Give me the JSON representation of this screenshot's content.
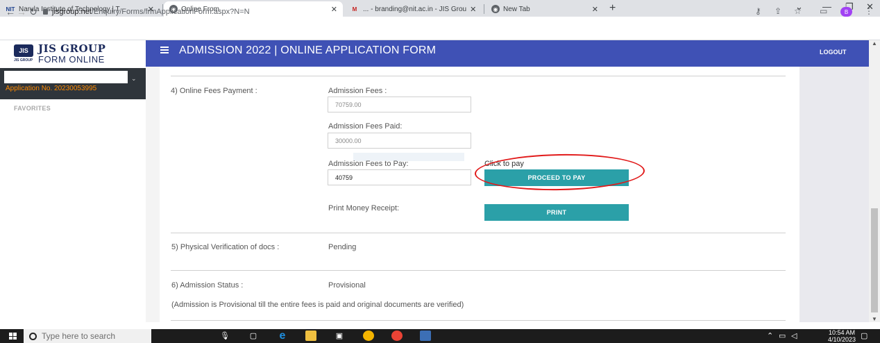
{
  "browser": {
    "tabs": [
      {
        "title": "Narula Institute of Technology | T",
        "favicon": "NIT"
      },
      {
        "title": "Online From",
        "favicon": "globe"
      },
      {
        "title": "... - branding@nit.ac.in - JIS Grou",
        "favicon": "mail"
      },
      {
        "title": "New Tab",
        "favicon": "globe"
      }
    ],
    "url_host": "jisgroup.net",
    "url_path": "/Enquiry/Forms/frmApplicationForm.aspx?N=N",
    "profile_initial": "B"
  },
  "header": {
    "logo_mark": "JIS",
    "logo_sub": "JIS GROUP",
    "logo_line1": "JIS GROUP",
    "logo_line2": "FORM ONLINE",
    "title": "ADMISSION 2022 | ONLINE APPLICATION FORM",
    "logout": "LOGOUT"
  },
  "sidebar": {
    "application_no": "Application No. 20230053995",
    "favorites": "FAVORITES"
  },
  "form": {
    "fees_section_label": "4) Online Fees Payment :",
    "admission_fees_label": "Admission Fees :",
    "admission_fees_value": "70759.00",
    "fees_paid_label": "Admission Fees Paid:",
    "fees_paid_value": "30000.00",
    "fees_to_pay_label": "Admission Fees to Pay:",
    "fees_to_pay_value": "40759",
    "click_to_pay": "Click to pay",
    "proceed_button": "PROCEED TO PAY",
    "receipt_label": "Print Money Receipt:",
    "print_button": "PRINT",
    "verification_label": "5) Physical Verification of docs :",
    "verification_value": "Pending",
    "status_label": "6) Admission Status :",
    "status_value": "Provisional",
    "status_note": "(Admission is Provisional till the entire fees is paid and original documents are verified)"
  },
  "taskbar": {
    "search_placeholder": "Type here to search",
    "time": "10:54 AM",
    "date": "4/10/2023"
  },
  "colors": {
    "header": "#3f51b5",
    "button": "#2ba0a8",
    "sidebar_panel": "#2f353b",
    "application_no": "#ff8a00",
    "highlight": "#e11a1a"
  }
}
